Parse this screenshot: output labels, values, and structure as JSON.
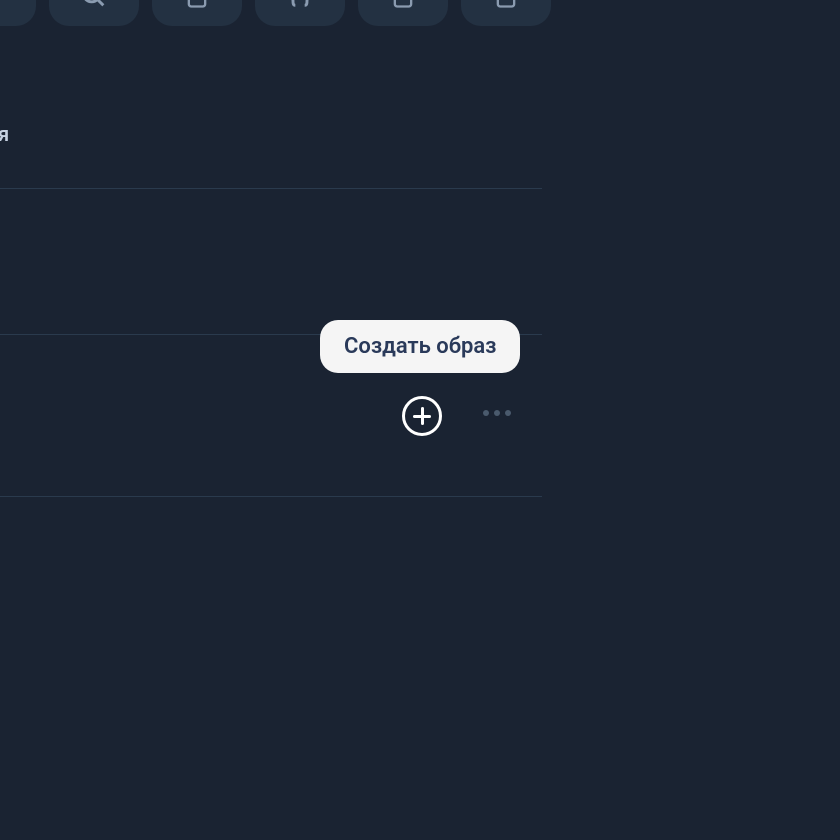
{
  "section_label": "я",
  "tooltip": {
    "create_label": "Создать образ"
  },
  "icons": {
    "search": "search-icon",
    "file": "file-icon",
    "braces": "braces-icon",
    "note": "note-icon",
    "document": "document-icon"
  },
  "colors": {
    "background": "#1a2332",
    "tile_background": "#233142",
    "tooltip_background": "#f5f5f5",
    "tooltip_text": "#2a3a5a",
    "divider": "#2a3a4d",
    "dots": "#4a5a6d"
  }
}
